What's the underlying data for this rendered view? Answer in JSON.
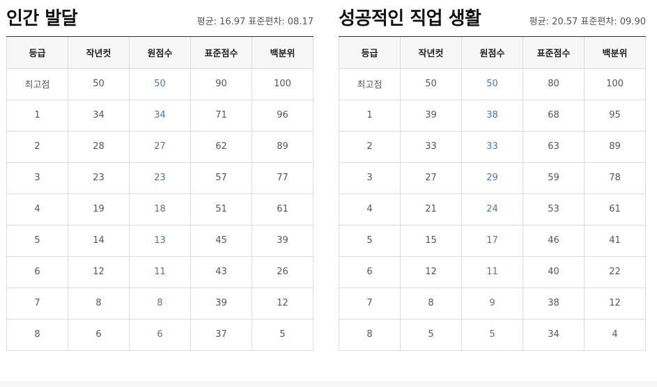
{
  "columns": [
    "등급",
    "작년컷",
    "원점수",
    "표준점수",
    "백분위"
  ],
  "left": {
    "title": "인간 발달",
    "stats": "평균: 16.97 표준편차: 08.17",
    "rows": [
      [
        "최고점",
        "50",
        "50",
        "90",
        "100"
      ],
      [
        "1",
        "34",
        "34",
        "71",
        "96"
      ],
      [
        "2",
        "28",
        "27",
        "62",
        "89"
      ],
      [
        "3",
        "23",
        "23",
        "57",
        "77"
      ],
      [
        "4",
        "19",
        "18",
        "51",
        "61"
      ],
      [
        "5",
        "14",
        "13",
        "45",
        "39"
      ],
      [
        "6",
        "12",
        "11",
        "43",
        "26"
      ],
      [
        "7",
        "8",
        "8",
        "39",
        "12"
      ],
      [
        "8",
        "6",
        "6",
        "37",
        "5"
      ]
    ]
  },
  "right": {
    "title": "성공적인 직업 생활",
    "stats": "평균: 20.57 표준편차: 09.90",
    "rows": [
      [
        "최고점",
        "50",
        "50",
        "80",
        "100"
      ],
      [
        "1",
        "39",
        "38",
        "68",
        "95"
      ],
      [
        "2",
        "33",
        "33",
        "63",
        "89"
      ],
      [
        "3",
        "27",
        "29",
        "59",
        "78"
      ],
      [
        "4",
        "21",
        "24",
        "53",
        "61"
      ],
      [
        "5",
        "15",
        "17",
        "46",
        "41"
      ],
      [
        "6",
        "12",
        "11",
        "40",
        "22"
      ],
      [
        "7",
        "8",
        "9",
        "38",
        "12"
      ],
      [
        "8",
        "5",
        "5",
        "34",
        "4"
      ]
    ]
  },
  "colors": {
    "raw_score": "#4a76b3",
    "header_bg": "#f7f7f7",
    "border": "#dcdcdc"
  }
}
